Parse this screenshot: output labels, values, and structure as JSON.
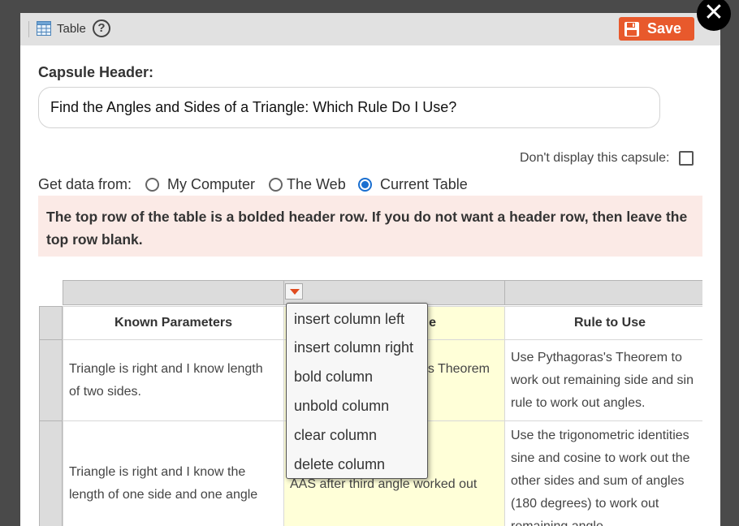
{
  "toolbar": {
    "title": "Table",
    "help": "?",
    "save_label": "Save",
    "close_symbol": "✕"
  },
  "capsule": {
    "header_label": "Capsule Header:",
    "header_value": "Find the Angles and Sides of a Triangle: Which Rule Do I Use?"
  },
  "options": {
    "dont_display_label": "Don't display this capsule:",
    "get_data_label": "Get data from:",
    "sources": [
      "My Computer",
      "The Web",
      "Current Table"
    ],
    "selected_source": "Current Table"
  },
  "notice": "The top row of the table is a bolded header row. If you do not want a header row, then leave the top row blank.",
  "table": {
    "headers": [
      "Known Parameters",
      "e",
      "Rule to Use"
    ],
    "rows": [
      {
        "c1_lines": [
          "Triangle is right and I know length",
          "of two sides."
        ],
        "c2_lines": [
          "s Theorem"
        ],
        "c3_lines": [
          "Use Pythagoras's Theorem to",
          "work out remaining side and sin",
          "rule to work out angles."
        ]
      },
      {
        "c1_lines": [
          "Triangle is right and I know the",
          "length of one side and one angle"
        ],
        "c2_lines": [
          "AAS after third angle worked out"
        ],
        "c3_lines": [
          "Use the trigonometric identities",
          "sine and cosine to work out the",
          "other sides and sum of angles",
          "(180 degrees) to work out",
          "remaining angle"
        ]
      }
    ]
  },
  "column_menu": [
    "insert column left",
    "insert column right",
    "bold column",
    "unbold column",
    "clear column",
    "delete column"
  ],
  "colors": {
    "save": "#e8592c",
    "radio_selected": "#1a6fd0",
    "notice_bg": "#fbeae6",
    "highlight_col": "#ffffd8"
  }
}
